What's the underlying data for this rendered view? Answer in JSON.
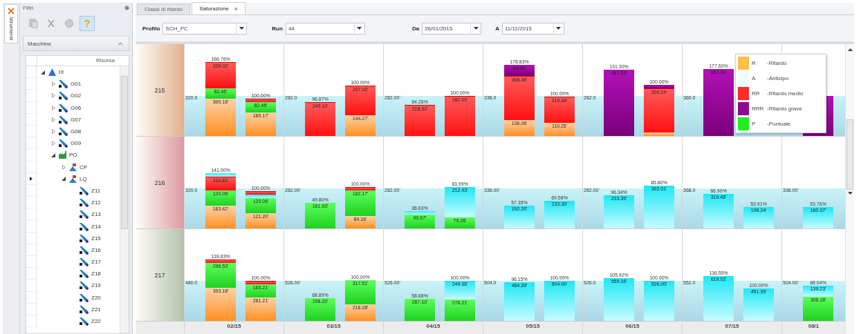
{
  "side_tab": {
    "label": "Strumenti"
  },
  "filter_panel": {
    "title": "Filtri",
    "toolbar": [
      {
        "kind": "copy",
        "selected": false
      },
      {
        "kind": "cut",
        "selected": false
      },
      {
        "kind": "paste",
        "selected": false
      },
      {
        "kind": "help",
        "glyph": "?",
        "selected": true
      }
    ],
    "section": {
      "title": "Macchine",
      "expanded": true
    },
    "grid": {
      "column": "Risorsa",
      "tree": [
        {
          "label": "IX",
          "kind": "site",
          "expanded": true,
          "current": false,
          "children": [
            {
              "label": "G01",
              "kind": "machine",
              "expanded": false,
              "current": false
            },
            {
              "label": "G02",
              "kind": "machine",
              "expanded": false,
              "current": false
            },
            {
              "label": "G06",
              "kind": "machine",
              "expanded": false,
              "current": false
            },
            {
              "label": "G07",
              "kind": "machine",
              "expanded": false,
              "current": false
            },
            {
              "label": "G08",
              "kind": "machine",
              "expanded": false,
              "current": false
            },
            {
              "label": "G09",
              "kind": "machine",
              "expanded": false,
              "current": false
            },
            {
              "label": "PO",
              "kind": "plant",
              "expanded": true,
              "current": false,
              "children": [
                {
                  "label": "CP",
                  "kind": "group",
                  "expanded": false,
                  "current": false
                },
                {
                  "label": "LQ",
                  "kind": "group",
                  "expanded": true,
                  "current": true,
                  "children": [
                    {
                      "label": "Z11",
                      "kind": "machine",
                      "current": false
                    },
                    {
                      "label": "Z12",
                      "kind": "machine",
                      "current": false
                    },
                    {
                      "label": "Z13",
                      "kind": "machine",
                      "current": false
                    },
                    {
                      "label": "Z14",
                      "kind": "machine",
                      "current": false
                    },
                    {
                      "label": "Z15",
                      "kind": "machine",
                      "current": false
                    },
                    {
                      "label": "Z16",
                      "kind": "machine",
                      "current": false
                    },
                    {
                      "label": "Z17",
                      "kind": "machine",
                      "current": false
                    },
                    {
                      "label": "Z18",
                      "kind": "machine",
                      "current": false
                    },
                    {
                      "label": "Z19",
                      "kind": "machine",
                      "current": false
                    },
                    {
                      "label": "Z20",
                      "kind": "machine",
                      "current": false
                    },
                    {
                      "label": "Z21",
                      "kind": "machine",
                      "current": false
                    },
                    {
                      "label": "Z22",
                      "kind": "machine",
                      "current": false
                    }
                  ]
                }
              ]
            }
          ]
        }
      ]
    }
  },
  "tabs": [
    {
      "label": "Classi di ritardo",
      "selected": false
    },
    {
      "label": "Saturazione",
      "selected": true,
      "close": "×"
    }
  ],
  "filters": [
    {
      "label": "Profilo",
      "value": "SCH_PC"
    },
    {
      "label": "Run",
      "value": "44"
    },
    {
      "label": "Da",
      "value": "26/01/2015"
    },
    {
      "label": "A",
      "value": "11/11/2015"
    }
  ],
  "legend": [
    {
      "code": "R",
      "label": "-Ritardo",
      "color": "#ffc04a"
    },
    {
      "code": "A",
      "label": "-Anticipo",
      "color": "#effcfd"
    },
    {
      "code": "RR",
      "label": "-Ritardo medio",
      "color": "#ff2a2a"
    },
    {
      "code": "RRR",
      "label": "-Ritardo grave",
      "color": "#8e0a8e"
    },
    {
      "code": "P",
      "label": "-Puntuale",
      "color": "#22ee22"
    }
  ],
  "months": [
    "02/15",
    "03/15",
    "04/15",
    "05/15",
    "06/15",
    "07/15",
    "08/1"
  ],
  "rows": [
    {
      "label": "215",
      "color": "#e3b08e",
      "cells": [
        {
          "capacity": "320.0",
          "bars": [
            {
              "pct": "166.76%",
              "segments": [
                {
                  "kind": "medio",
                  "value": "209.02'"
                },
                {
                  "kind": "puntuale",
                  "value": "82.45'"
                },
                {
                  "kind": "ritardo",
                  "value": "300.18'"
                }
              ]
            },
            {
              "pct": "100.00%",
              "segments": [
                {
                  "kind": "medio"
                },
                {
                  "kind": "puntuale",
                  "value": "82.45'"
                },
                {
                  "kind": "ritardo",
                  "value": "189.17'"
                }
              ]
            }
          ]
        },
        {
          "capacity": "282.0",
          "bars": [
            {
              "pct": "96.87%",
              "segments": [
                {
                  "kind": "medio",
                  "value": "240.10'"
                }
              ]
            },
            {
              "pct": "100.00%",
              "segments": [
                {
                  "kind": "medio",
                  "value": "207.02'"
                },
                {
                  "kind": "ritardo",
                  "value": "144.27'"
                }
              ]
            }
          ]
        },
        {
          "capacity": "282.00'",
          "bars": [
            {
              "pct": "64.26%",
              "segments": [
                {
                  "kind": "medio",
                  "value": "218.32'"
                }
              ]
            },
            {
              "pct": "100.00%",
              "segments": [
                {
                  "kind": "medio",
                  "value": "282.00'"
                }
              ]
            }
          ]
        },
        {
          "capacity": "336.0",
          "bars": [
            {
              "pct": "178.83%",
              "segments": [
                {
                  "kind": "grave",
                  "value": "93.02'"
                },
                {
                  "kind": "medio",
                  "value": "368.48'"
                },
                {
                  "kind": "ritardo",
                  "value": "136.08'"
                }
              ]
            },
            {
              "pct": "100.00%",
              "segments": [
                {
                  "kind": "medio",
                  "value": "219.34'"
                },
                {
                  "kind": "ritardo",
                  "value": "110.25'"
                }
              ]
            }
          ]
        },
        {
          "capacity": "282.0",
          "bars": [
            {
              "pct": "131.30%",
              "segments": [
                {
                  "kind": "grave",
                  "value": "467.53'"
                }
              ]
            },
            {
              "pct": "100.00%",
              "segments": [
                {
                  "kind": "grave"
                },
                {
                  "kind": "medio",
                  "value": "309.24'"
                },
                {
                  "kind": "ritardo"
                }
              ]
            }
          ]
        },
        {
          "capacity": "360.0",
          "bars": [
            {
              "pct": "177.60%",
              "segments": [
                {
                  "kind": "grave",
                  "value": "602.90'"
                }
              ]
            }
          ]
        },
        {
          "bars": [
            {
              "segments": [
                {
                  "kind": "grave"
                }
              ]
            }
          ]
        }
      ]
    },
    {
      "label": "216",
      "color": "#dc9aa2",
      "cells": [
        {
          "capacity": "320.0",
          "bars": [
            {
              "pct": "141.00%",
              "segments": [
                {
                  "kind": "anticipo"
                },
                {
                  "kind": "medio",
                  "value": "110.83'"
                },
                {
                  "kind": "puntuale",
                  "value": "120.06'"
                },
                {
                  "kind": "ritardo",
                  "value": "183.42'"
                }
              ]
            },
            {
              "pct": "100.00%",
              "segments": [
                {
                  "kind": "medio"
                },
                {
                  "kind": "anticipo"
                },
                {
                  "kind": "puntuale",
                  "value": "120.06'"
                },
                {
                  "kind": "ritardo",
                  "value": "121.20'"
                }
              ]
            }
          ]
        },
        {
          "capacity": "282.00'",
          "bars": [
            {
              "pct": "49.80%",
              "segments": [
                {
                  "kind": "puntuale",
                  "value": "181.93'"
                }
              ]
            },
            {
              "pct": "100.00%",
              "segments": [
                {
                  "kind": "medio"
                },
                {
                  "kind": "puntuale",
                  "value": "182.17'"
                },
                {
                  "kind": "ritardo",
                  "value": "89.16'"
                }
              ]
            }
          ]
        },
        {
          "capacity": "282.00'",
          "bars": [
            {
              "pct": "36.63%",
              "segments": [
                {
                  "kind": "anticipo"
                },
                {
                  "kind": "puntuale",
                  "value": "99.57'"
                }
              ]
            },
            {
              "pct": "83.99%",
              "segments": [
                {
                  "kind": "anticipo",
                  "value": "212.43'"
                },
                {
                  "kind": "puntuale",
                  "value": "79.26'"
                }
              ]
            }
          ]
        },
        {
          "capacity": "336.00'",
          "bars": [
            {
              "pct": "57.35%",
              "segments": [
                {
                  "kind": "anticipo",
                  "value": "192.20'"
                }
              ]
            },
            {
              "pct": "69.58%",
              "segments": [
                {
                  "kind": "anticipo",
                  "value": "233.30'"
                }
              ]
            }
          ]
        },
        {
          "capacity": "282.00'",
          "bars": [
            {
              "pct": "96.34%",
              "segments": [
                {
                  "kind": "anticipo",
                  "value": "233.35'"
                }
              ]
            },
            {
              "pct": "85.80%",
              "segments": [
                {
                  "kind": "anticipo",
                  "value": "302.01'"
                }
              ]
            }
          ]
        },
        {
          "capacity": "368.0",
          "bars": [
            {
              "pct": "86.90%",
              "segments": [
                {
                  "kind": "anticipo",
                  "value": "319.48'"
                }
              ]
            },
            {
              "pct": "53.91%",
              "segments": [
                {
                  "kind": "anticipo",
                  "value": "198.24'"
                }
              ]
            }
          ]
        },
        {
          "capacity": "336.00'",
          "bars": [
            {
              "pct": "53.76%",
              "segments": [
                {
                  "kind": "anticipo",
                  "value": "180.37'"
                }
              ]
            }
          ]
        }
      ]
    },
    {
      "label": "217",
      "color": "#b4c2ac",
      "cells": [
        {
          "capacity": "480.0",
          "bars": [
            {
              "pct": "139.83%",
              "segments": [
                {
                  "kind": "medio"
                },
                {
                  "kind": "puntuale",
                  "value": "296.53'"
                },
                {
                  "kind": "ritardo",
                  "value": "393.18'"
                }
              ]
            },
            {
              "pct": "100.00%",
              "segments": [
                {
                  "kind": "medio"
                },
                {
                  "kind": "puntuale",
                  "value": "160.21'"
                },
                {
                  "kind": "ritardo",
                  "value": "281.21'"
                }
              ]
            }
          ]
        },
        {
          "capacity": "526.00'",
          "bars": [
            {
              "pct": "68.89%",
              "segments": [
                {
                  "kind": "puntuale",
                  "value": "298.20'"
                }
              ]
            },
            {
              "pct": "100.00%",
              "segments": [
                {
                  "kind": "puntuale",
                  "value": "317.51'"
                },
                {
                  "kind": "ritardo",
                  "value": "218.28'"
                }
              ]
            }
          ]
        },
        {
          "capacity": "526.00'",
          "bars": [
            {
              "pct": "58.68%",
              "segments": [
                {
                  "kind": "puntuale",
                  "value": "287.10'"
                }
              ]
            },
            {
              "pct": "100.00%",
              "segments": [
                {
                  "kind": "anticipo",
                  "value": "249.36'"
                },
                {
                  "kind": "puntuale",
                  "value": "278.21'"
                }
              ]
            }
          ]
        },
        {
          "capacity": "504.0",
          "bars": [
            {
              "pct": "96.15%",
              "segments": [
                {
                  "kind": "anticipo",
                  "value": "484.39'"
                }
              ]
            },
            {
              "pct": "100.00%",
              "segments": [
                {
                  "kind": "anticipo",
                  "value": "504.00'"
                }
              ]
            }
          ]
        },
        {
          "capacity": "526.0",
          "bars": [
            {
              "pct": "105.92%",
              "segments": [
                {
                  "kind": "anticipo",
                  "value": "559.16'"
                }
              ]
            },
            {
              "pct": "100.00%",
              "segments": [
                {
                  "kind": "anticipo",
                  "value": "526.00'"
                }
              ]
            }
          ]
        },
        {
          "capacity": "552.0",
          "bars": [
            {
              "pct": "136.55%",
              "segments": [
                {
                  "kind": "anticipo",
                  "value": "619.02'"
                }
              ]
            },
            {
              "pct": "100.00%",
              "segments": [
                {
                  "kind": "anticipo",
                  "value": "451.39'"
                }
              ]
            }
          ]
        },
        {
          "capacity": "504.00'",
          "bars": [
            {
              "pct": "88.04%",
              "segments": [
                {
                  "kind": "anticipo",
                  "value": "139.23'"
                },
                {
                  "kind": "puntuale",
                  "value": "306.18'"
                }
              ]
            }
          ]
        }
      ]
    }
  ]
}
